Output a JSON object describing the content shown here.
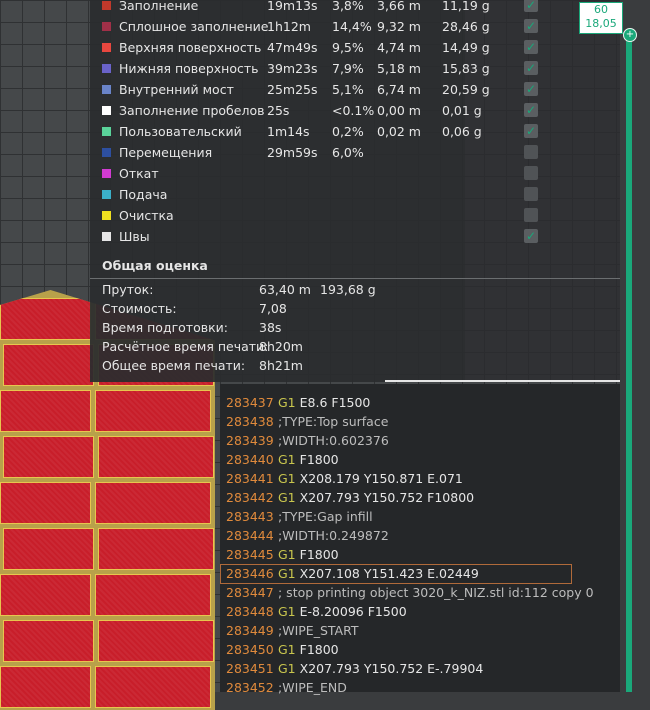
{
  "legend": [
    {
      "name": "Заполнение",
      "color": "#c0392b",
      "time": "19m13s",
      "pct": "3,8%",
      "len": "3,66 m",
      "weight": "11,19 g",
      "visible": true
    },
    {
      "name": "Сплошное заполнение",
      "color": "#a03048",
      "time": "1h12m",
      "pct": "14,4%",
      "len": "9,32 m",
      "weight": "28,46 g",
      "visible": true
    },
    {
      "name": "Верхняя поверхность",
      "color": "#e8473f",
      "time": "47m49s",
      "pct": "9,5%",
      "len": "4,74 m",
      "weight": "14,49 g",
      "visible": true
    },
    {
      "name": "Нижняя поверхность",
      "color": "#6a63c9",
      "time": "39m23s",
      "pct": "7,9%",
      "len": "5,18 m",
      "weight": "15,83 g",
      "visible": true
    },
    {
      "name": "Внутренний мост",
      "color": "#6a84c9",
      "time": "25m25s",
      "pct": "5,1%",
      "len": "6,74 m",
      "weight": "20,59 g",
      "visible": true
    },
    {
      "name": "Заполнение пробелов",
      "color": "#ffffff",
      "time": "25s",
      "pct": "<0.1%",
      "len": "0,00 m",
      "weight": "0,01 g",
      "visible": true
    },
    {
      "name": "Пользовательский",
      "color": "#5ad39a",
      "time": "1m14s",
      "pct": "0,2%",
      "len": "0,02 m",
      "weight": "0,06 g",
      "visible": true
    },
    {
      "name": "Перемещения",
      "color": "#2d4fa0",
      "time": "29m59s",
      "pct": "6,0%",
      "len": "",
      "weight": "",
      "visible": false
    },
    {
      "name": "Откат",
      "color": "#d23bd2",
      "time": "",
      "pct": "",
      "len": "",
      "weight": "",
      "visible": false
    },
    {
      "name": "Подача",
      "color": "#3bb0c9",
      "time": "",
      "pct": "",
      "len": "",
      "weight": "",
      "visible": false
    },
    {
      "name": "Очистка",
      "color": "#f0e020",
      "time": "",
      "pct": "",
      "len": "",
      "weight": "",
      "visible": false
    },
    {
      "name": "Швы",
      "color": "#e6e6e6",
      "time": "",
      "pct": "",
      "len": "",
      "weight": "",
      "visible": true
    }
  ],
  "summary": {
    "title": "Общая оценка",
    "filament_label": "Пруток:",
    "filament_length": "63,40 m",
    "filament_weight": "193,68 g",
    "cost_label": "Стоимость:",
    "cost": "7,08",
    "prep_label": "Время подготовки:",
    "prep": "38s",
    "calc_label": "Расчётное время печати:",
    "calc": "8h20m",
    "total_label": "Общее время печати:",
    "total": "8h21m"
  },
  "gcode": [
    {
      "n": "283437",
      "cmd": "G1",
      "args": "E8.6 F1500",
      "comment": ""
    },
    {
      "n": "283438",
      "cmd": "",
      "args": "",
      "comment": ";TYPE:Top surface"
    },
    {
      "n": "283439",
      "cmd": "",
      "args": "",
      "comment": ";WIDTH:0.602376"
    },
    {
      "n": "283440",
      "cmd": "G1",
      "args": "F1800",
      "comment": ""
    },
    {
      "n": "283441",
      "cmd": "G1",
      "args": "X208.179 Y150.871 E.071",
      "comment": ""
    },
    {
      "n": "283442",
      "cmd": "G1",
      "args": "X207.793 Y150.752 F10800",
      "comment": ""
    },
    {
      "n": "283443",
      "cmd": "",
      "args": "",
      "comment": ";TYPE:Gap infill"
    },
    {
      "n": "283444",
      "cmd": "",
      "args": "",
      "comment": ";WIDTH:0.249872"
    },
    {
      "n": "283445",
      "cmd": "G1",
      "args": "F1800",
      "comment": ""
    },
    {
      "n": "283446",
      "cmd": "G1",
      "args": "X207.108 Y151.423 E.02449",
      "comment": ""
    },
    {
      "n": "283447",
      "cmd": "",
      "args": "",
      "comment": "; stop printing object 3020_k_NIZ.stl id:112 copy 0"
    },
    {
      "n": "283448",
      "cmd": "G1",
      "args": "E-8.20096 F1500",
      "comment": ""
    },
    {
      "n": "283449",
      "cmd": "",
      "args": "",
      "comment": ";WIPE_START"
    },
    {
      "n": "283450",
      "cmd": "G1",
      "args": "F1800",
      "comment": ""
    },
    {
      "n": "283451",
      "cmd": "G1",
      "args": "X207.793 Y150.752 E-.79904",
      "comment": ""
    },
    {
      "n": "283452",
      "cmd": "",
      "args": "",
      "comment": ";WIPE_END"
    }
  ],
  "highlighted_line": "283446",
  "slider": {
    "layer": "60",
    "height": "18,05",
    "handle_icon": "plus-icon"
  },
  "colors": {
    "accent": "#1aa87a",
    "line_number": "#e08a3c",
    "gcode_cmd": "#c9c64e"
  }
}
